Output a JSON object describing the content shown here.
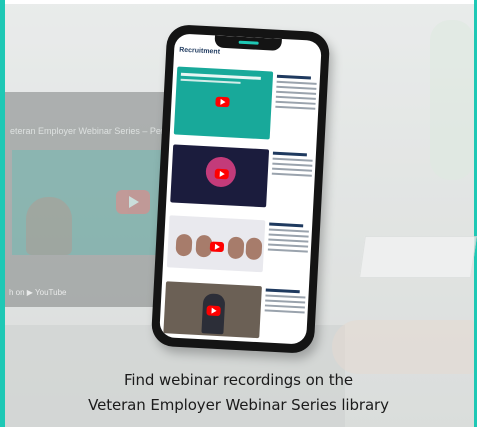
{
  "caption": {
    "line1": "Find webinar recordings on the",
    "line2": "Veteran Employer Webinar Series library"
  },
  "phone": {
    "header": "Recruitment"
  },
  "background": {
    "laptop_title": "eteran Employer Webinar Series – Perfe",
    "watch_on": "h on ▶ YouTube"
  },
  "colors": {
    "accent": "#1ec8b5",
    "play_red": "#ff0000"
  }
}
